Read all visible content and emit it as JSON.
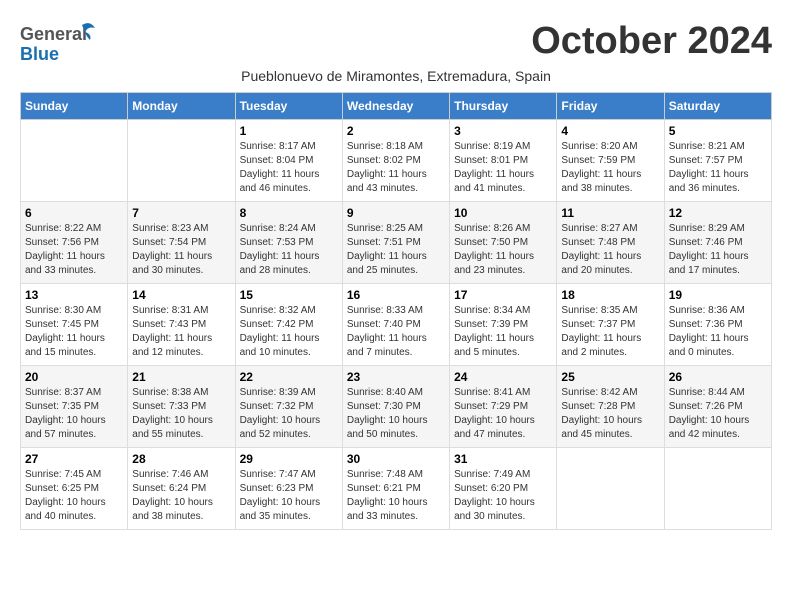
{
  "header": {
    "logo_general": "General",
    "logo_blue": "Blue",
    "month_title": "October 2024",
    "location": "Pueblonuevo de Miramontes, Extremadura, Spain"
  },
  "weekdays": [
    "Sunday",
    "Monday",
    "Tuesday",
    "Wednesday",
    "Thursday",
    "Friday",
    "Saturday"
  ],
  "weeks": [
    [
      {
        "day": "",
        "info": ""
      },
      {
        "day": "",
        "info": ""
      },
      {
        "day": "1",
        "info": "Sunrise: 8:17 AM\nSunset: 8:04 PM\nDaylight: 11 hours and 46 minutes."
      },
      {
        "day": "2",
        "info": "Sunrise: 8:18 AM\nSunset: 8:02 PM\nDaylight: 11 hours and 43 minutes."
      },
      {
        "day": "3",
        "info": "Sunrise: 8:19 AM\nSunset: 8:01 PM\nDaylight: 11 hours and 41 minutes."
      },
      {
        "day": "4",
        "info": "Sunrise: 8:20 AM\nSunset: 7:59 PM\nDaylight: 11 hours and 38 minutes."
      },
      {
        "day": "5",
        "info": "Sunrise: 8:21 AM\nSunset: 7:57 PM\nDaylight: 11 hours and 36 minutes."
      }
    ],
    [
      {
        "day": "6",
        "info": "Sunrise: 8:22 AM\nSunset: 7:56 PM\nDaylight: 11 hours and 33 minutes."
      },
      {
        "day": "7",
        "info": "Sunrise: 8:23 AM\nSunset: 7:54 PM\nDaylight: 11 hours and 30 minutes."
      },
      {
        "day": "8",
        "info": "Sunrise: 8:24 AM\nSunset: 7:53 PM\nDaylight: 11 hours and 28 minutes."
      },
      {
        "day": "9",
        "info": "Sunrise: 8:25 AM\nSunset: 7:51 PM\nDaylight: 11 hours and 25 minutes."
      },
      {
        "day": "10",
        "info": "Sunrise: 8:26 AM\nSunset: 7:50 PM\nDaylight: 11 hours and 23 minutes."
      },
      {
        "day": "11",
        "info": "Sunrise: 8:27 AM\nSunset: 7:48 PM\nDaylight: 11 hours and 20 minutes."
      },
      {
        "day": "12",
        "info": "Sunrise: 8:29 AM\nSunset: 7:46 PM\nDaylight: 11 hours and 17 minutes."
      }
    ],
    [
      {
        "day": "13",
        "info": "Sunrise: 8:30 AM\nSunset: 7:45 PM\nDaylight: 11 hours and 15 minutes."
      },
      {
        "day": "14",
        "info": "Sunrise: 8:31 AM\nSunset: 7:43 PM\nDaylight: 11 hours and 12 minutes."
      },
      {
        "day": "15",
        "info": "Sunrise: 8:32 AM\nSunset: 7:42 PM\nDaylight: 11 hours and 10 minutes."
      },
      {
        "day": "16",
        "info": "Sunrise: 8:33 AM\nSunset: 7:40 PM\nDaylight: 11 hours and 7 minutes."
      },
      {
        "day": "17",
        "info": "Sunrise: 8:34 AM\nSunset: 7:39 PM\nDaylight: 11 hours and 5 minutes."
      },
      {
        "day": "18",
        "info": "Sunrise: 8:35 AM\nSunset: 7:37 PM\nDaylight: 11 hours and 2 minutes."
      },
      {
        "day": "19",
        "info": "Sunrise: 8:36 AM\nSunset: 7:36 PM\nDaylight: 11 hours and 0 minutes."
      }
    ],
    [
      {
        "day": "20",
        "info": "Sunrise: 8:37 AM\nSunset: 7:35 PM\nDaylight: 10 hours and 57 minutes."
      },
      {
        "day": "21",
        "info": "Sunrise: 8:38 AM\nSunset: 7:33 PM\nDaylight: 10 hours and 55 minutes."
      },
      {
        "day": "22",
        "info": "Sunrise: 8:39 AM\nSunset: 7:32 PM\nDaylight: 10 hours and 52 minutes."
      },
      {
        "day": "23",
        "info": "Sunrise: 8:40 AM\nSunset: 7:30 PM\nDaylight: 10 hours and 50 minutes."
      },
      {
        "day": "24",
        "info": "Sunrise: 8:41 AM\nSunset: 7:29 PM\nDaylight: 10 hours and 47 minutes."
      },
      {
        "day": "25",
        "info": "Sunrise: 8:42 AM\nSunset: 7:28 PM\nDaylight: 10 hours and 45 minutes."
      },
      {
        "day": "26",
        "info": "Sunrise: 8:44 AM\nSunset: 7:26 PM\nDaylight: 10 hours and 42 minutes."
      }
    ],
    [
      {
        "day": "27",
        "info": "Sunrise: 7:45 AM\nSunset: 6:25 PM\nDaylight: 10 hours and 40 minutes."
      },
      {
        "day": "28",
        "info": "Sunrise: 7:46 AM\nSunset: 6:24 PM\nDaylight: 10 hours and 38 minutes."
      },
      {
        "day": "29",
        "info": "Sunrise: 7:47 AM\nSunset: 6:23 PM\nDaylight: 10 hours and 35 minutes."
      },
      {
        "day": "30",
        "info": "Sunrise: 7:48 AM\nSunset: 6:21 PM\nDaylight: 10 hours and 33 minutes."
      },
      {
        "day": "31",
        "info": "Sunrise: 7:49 AM\nSunset: 6:20 PM\nDaylight: 10 hours and 30 minutes."
      },
      {
        "day": "",
        "info": ""
      },
      {
        "day": "",
        "info": ""
      }
    ]
  ]
}
